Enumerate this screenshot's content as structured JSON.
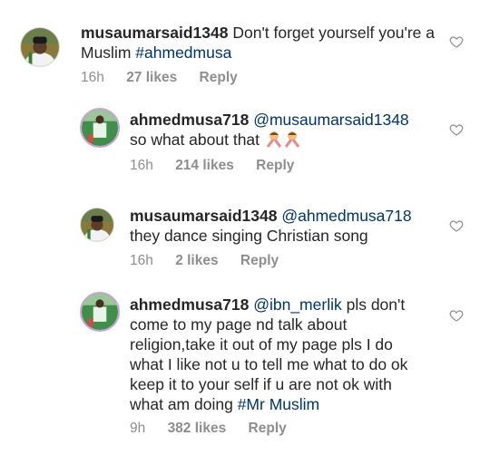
{
  "comments": [
    {
      "username": "musaumarsaid1348",
      "mention": "",
      "text": "Don't forget yourself you're a Muslim",
      "hashtag": "#ahmedmusa",
      "time": "16h",
      "likes": "27 likes",
      "reply": "Reply",
      "avatar": "avatar-man-cap-icon"
    },
    {
      "username": "ahmedmusa718",
      "mention": "@musaumarsaid1348",
      "text": "so what about that",
      "emoji": "man-gesturing-no-emoji",
      "time": "16h",
      "likes": "214 likes",
      "reply": "Reply",
      "avatar": "avatar-player-icon"
    },
    {
      "username": "musaumarsaid1348",
      "mention": "@ahmedmusa718",
      "text": "they dance singing Christian song",
      "time": "16h",
      "likes": "2 likes",
      "reply": "Reply",
      "avatar": "avatar-man-cap-icon"
    },
    {
      "username": "ahmedmusa718",
      "mention": "@ibn_merlik",
      "text": "pls don't come to my page nd talk about religion,take it out of my page pls I do what I like not u to tell me what to do ok keep it to your self if u are not ok with what am doing",
      "hashtag": "#Mr Muslim",
      "time": "9h",
      "likes": "382 likes",
      "reply": "Reply",
      "avatar": "avatar-player-icon"
    }
  ],
  "colors": {
    "text": "#262626",
    "meta": "#8e8e8e",
    "link": "#003569",
    "heart": "#8e8e8e"
  },
  "icons": [
    "heart-outline-icon",
    "avatar-man-cap-icon",
    "avatar-player-icon",
    "man-gesturing-no-emoji"
  ]
}
